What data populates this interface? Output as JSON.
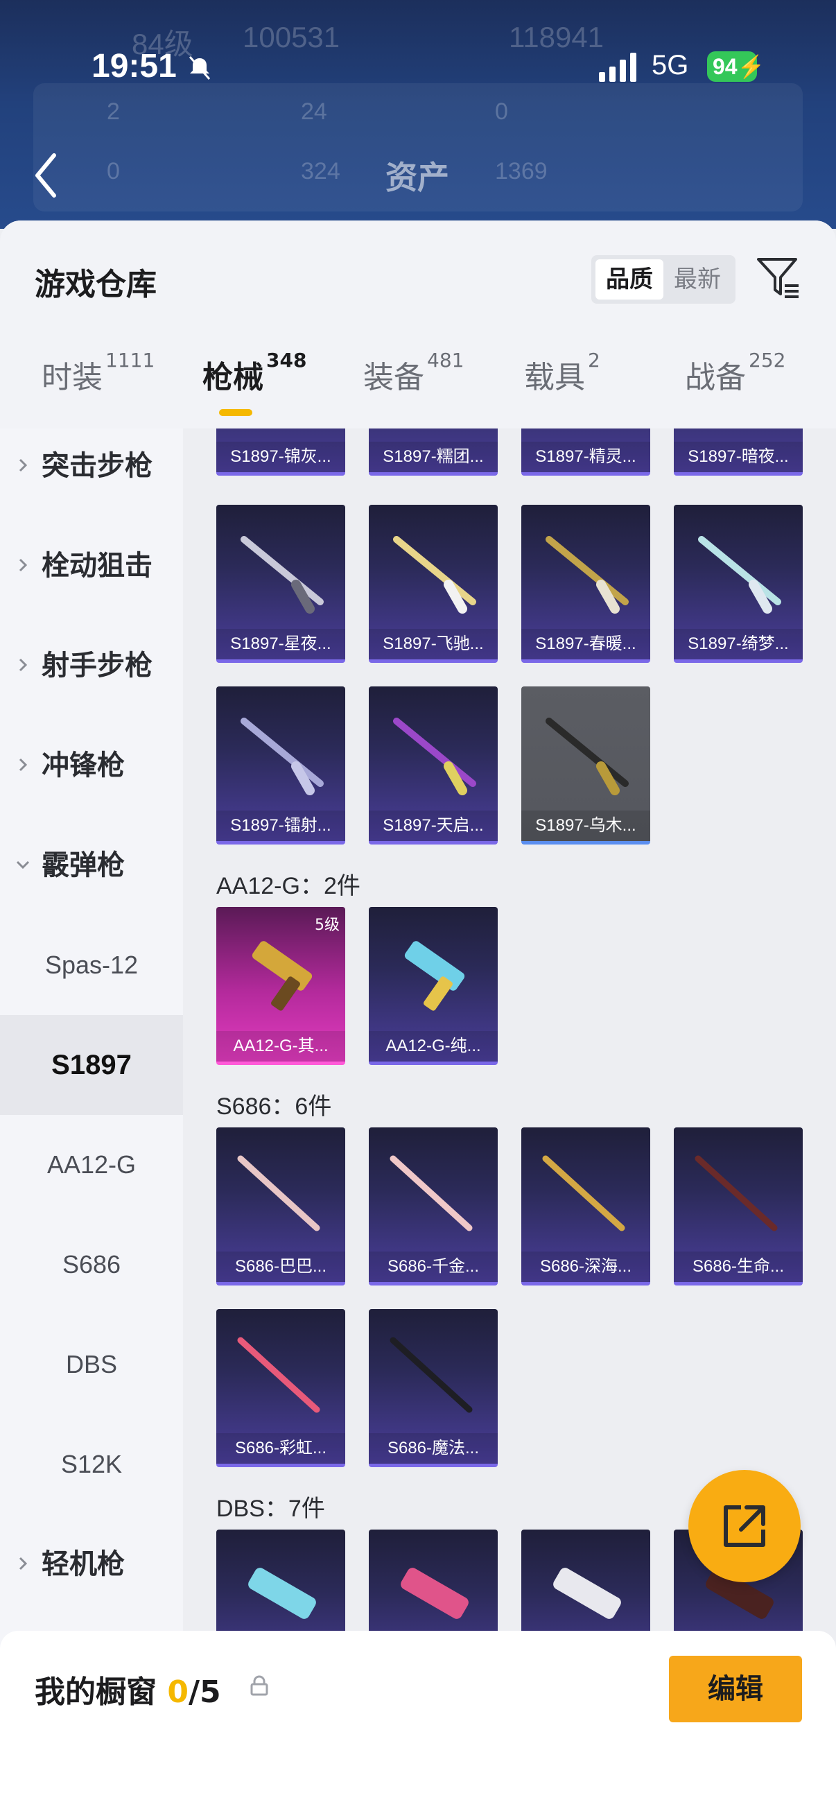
{
  "status_bar": {
    "time": "19:51",
    "network": "5G",
    "battery": "94"
  },
  "background": {
    "level": "84级",
    "id_value": "100531",
    "score": "118941",
    "stats_row1": [
      "2",
      "24",
      "0"
    ],
    "stats_row2": [
      "0",
      "324",
      "1369"
    ],
    "title": "资产"
  },
  "sheet": {
    "title": "游戏仓库",
    "sort": {
      "active": "品质",
      "inactive": "最新"
    }
  },
  "tabs": [
    {
      "label": "时装",
      "count": "1111"
    },
    {
      "label": "枪械",
      "count": "348"
    },
    {
      "label": "装备",
      "count": "481"
    },
    {
      "label": "载具",
      "count": "2"
    },
    {
      "label": "战备",
      "count": "252"
    }
  ],
  "sidebar": {
    "categories": [
      "突击步枪",
      "栓动狙击",
      "射手步枪",
      "冲锋枪",
      "霰弹枪",
      "轻机枪"
    ],
    "subs": [
      "Spas-12",
      "S1897",
      "AA12-G",
      "S686",
      "DBS",
      "S12K"
    ]
  },
  "groups": {
    "aa12": "AA12-G：2件",
    "s686": "S686：6件",
    "dbs": "DBS：7件"
  },
  "cards": {
    "s1897_top": [
      "S1897-锦灰...",
      "S1897-糯团...",
      "S1897-精灵...",
      "S1897-暗夜..."
    ],
    "s1897_row2": [
      "S1897-星夜...",
      "S1897-飞驰...",
      "S1897-春暖...",
      "S1897-绮梦..."
    ],
    "s1897_row3": [
      "S1897-镭射...",
      "S1897-天启...",
      "S1897-乌木..."
    ],
    "aa12": [
      "AA12-G-其...",
      "AA12-G-纯..."
    ],
    "aa12_badge": "5级",
    "s686_row1": [
      "S686-巴巴...",
      "S686-千金...",
      "S686-深海...",
      "S686-生命..."
    ],
    "s686_row2": [
      "S686-彩虹...",
      "S686-魔法..."
    ]
  },
  "showcase": {
    "label": "我的橱窗",
    "current": "0",
    "total": "/5",
    "edit_label": "编辑"
  },
  "colors": {
    "accent": "#f5b800",
    "fab": "#f9ac12",
    "edit": "#f7a71a",
    "card_purple": "#4a3e9a"
  }
}
